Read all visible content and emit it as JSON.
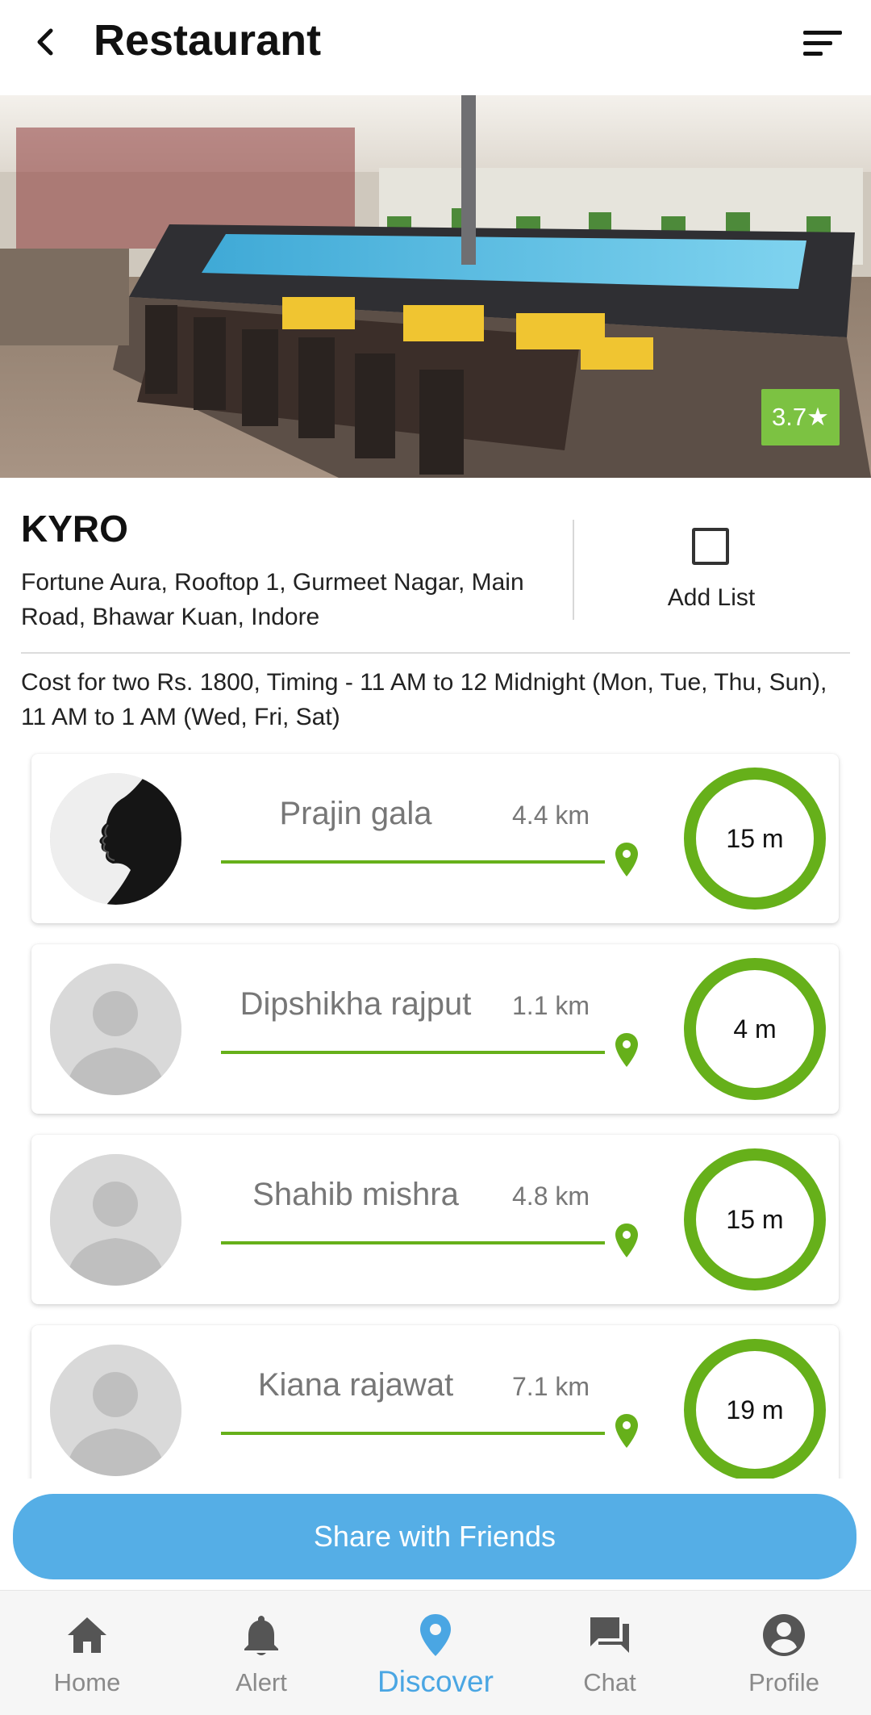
{
  "header": {
    "title": "Restaurant",
    "back_icon": "chevron-left-icon",
    "filter_icon": "sort-filter-icon"
  },
  "restaurant": {
    "rating": "3.7★",
    "name": "KYRO",
    "address": "Fortune Aura, Rooftop 1, Gurmeet Nagar, Main Road, Bhawar Kuan, Indore",
    "add_list_label": "Add List",
    "details": "Cost for two Rs. 1800,  Timing - 11 AM to 12 Midnight (Mon, Tue, Thu, Sun), 11 AM to 1 AM (Wed, Fri, Sat)"
  },
  "friends": [
    {
      "name": "Prajin gala",
      "distance": "4.4 km",
      "time": "15 m",
      "avatar": "photo"
    },
    {
      "name": "Dipshikha rajput",
      "distance": "1.1 km",
      "time": "4 m",
      "avatar": "placeholder"
    },
    {
      "name": "Shahib mishra",
      "distance": "4.8 km",
      "time": "15 m",
      "avatar": "placeholder"
    },
    {
      "name": "Kiana rajawat",
      "distance": "7.1 km",
      "time": "19 m",
      "avatar": "placeholder"
    }
  ],
  "share_button": {
    "label": "Share with Friends"
  },
  "nav": [
    {
      "label": "Home",
      "icon": "home-icon"
    },
    {
      "label": "Alert",
      "icon": "bell-icon"
    },
    {
      "label": "Discover",
      "icon": "map-pin-icon",
      "active": true
    },
    {
      "label": "Chat",
      "icon": "chat-icon"
    },
    {
      "label": "Profile",
      "icon": "account-circle-icon"
    }
  ],
  "colors": {
    "accent_green": "#66b01a",
    "rating_green": "#7cc242",
    "share_blue": "#55aee6",
    "active_nav_blue": "#4aa6e3"
  }
}
